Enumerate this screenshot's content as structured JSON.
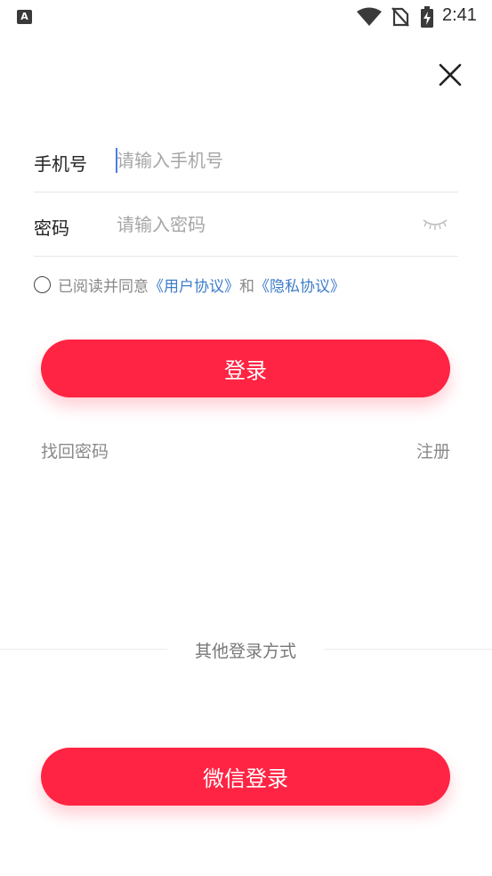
{
  "status_bar": {
    "time": "2:41",
    "app_icon_letter": "A",
    "icons": [
      "wifi-icon",
      "no-sim-icon",
      "battery-charging-icon"
    ]
  },
  "form": {
    "phone": {
      "label": "手机号",
      "placeholder": "请输入手机号",
      "value": ""
    },
    "password": {
      "label": "密码",
      "placeholder": "请输入密码",
      "value": ""
    }
  },
  "agreement": {
    "prefix": "已阅读并同意",
    "user_agreement": "《用户协议》",
    "and": "和",
    "privacy_agreement": "《隐私协议》",
    "checked": false
  },
  "buttons": {
    "login": "登录",
    "wechat_login": "微信登录"
  },
  "links": {
    "forgot_password": "找回密码",
    "register": "注册"
  },
  "other_login_label": "其他登录方式",
  "colors": {
    "primary": "#ff2443",
    "link": "#3d7cc9",
    "placeholder": "#a6a6a6"
  }
}
